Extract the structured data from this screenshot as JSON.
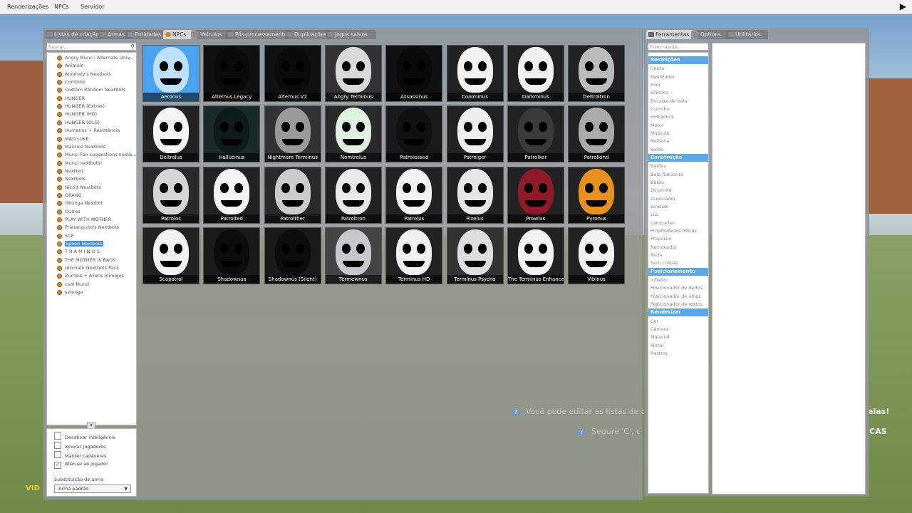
{
  "menubar": {
    "items": [
      "Renderizações",
      "NPCs",
      "Servidor"
    ]
  },
  "tabs": [
    "Listas de criação",
    "Armas",
    "Entidades",
    "NPCs",
    "Veículos",
    "Pós-processamento",
    "Duplicações",
    "Jogos salvos"
  ],
  "active_tab": "NPCs",
  "search_placeholder": "Buscar...",
  "categories": [
    "Angry Munci: Alternate Univ...",
    "Animals",
    "Anomaly's Nextbots",
    "Combine",
    "Custom Random Nextbots",
    "HUNGER",
    "HUNGER (Extras)",
    "HUNGER (HD)",
    "HUNGER (OLD)",
    "Humanos + Resistência",
    "MAD LUKE",
    "Maurice Nextbots",
    "Munci Fan suggestions nextb...",
    "Munci nextbots!",
    "Nextbot",
    "Nextbots",
    "Nico's Nextbots",
    "ORANG",
    "Obunga Nextbot",
    "Outros",
    "PLAY WITH MOTHER",
    "Prietanguito's Nextbots",
    "SCP",
    "Spoon Nextbots",
    "T R A M I N O S",
    "THE MOTHER IS BACK",
    "Ultimate Nextbots Pack",
    "Zumbis + Aliens Inimigos",
    "cool Munci",
    "selenga"
  ],
  "selected_category": "Spoon Nextbots",
  "options": [
    {
      "label": "Desativar inteligência",
      "checked": false
    },
    {
      "label": "Ignorar jogadores",
      "checked": false
    },
    {
      "label": "Manter cadáveres",
      "checked": false
    },
    {
      "label": "Aliar-se ao jogador",
      "checked": true
    }
  ],
  "weapon_label": "Substituição de arma",
  "weapon_value": "Arma padrão",
  "npcs": [
    "Aeronus",
    "Alternus Legacy",
    "Alternus V2",
    "Angry Terminus",
    "Assassinus",
    "Coolminus",
    "Darkminus",
    "Deltroltron",
    "Deltrolus",
    "Hallucinus",
    "Nightmare Terminus",
    "Nomtrolus",
    "Patrolessed",
    "Patrolger",
    "Patrolker",
    "Patrolkind",
    "Patrolos",
    "Patrolted",
    "Patrolther",
    "Patroltron",
    "Patrolus",
    "Pixelus",
    "Prowlus",
    "Pyronus",
    "Scapatrol",
    "Shadownus",
    "Shadownus (Silent)",
    "Termewnus",
    "Terminus HD",
    "Terminus Psycho",
    "The Terminus Enhance",
    "Vibinus"
  ],
  "hints": {
    "line1": "Você pode editar as listas de c",
    "line1_right": "elas!",
    "line2": "Segure 'C', c",
    "line2_right": "CAS",
    "corner": "VID"
  },
  "right_tabs": [
    "Ferramentas",
    "Options",
    "Utilitários"
  ],
  "filter_placeholder": "Filtro rápido...",
  "tool_groups": [
    {
      "name": "Restrições",
      "tools": [
        "Corda",
        "Deslizador",
        "Eixo",
        "Elástico",
        "Encaixe de bola",
        "Guincho",
        "Hidráulica",
        "Motor",
        "Músculo",
        "Roldana",
        "Solda"
      ]
    },
    {
      "name": "Construção",
      "tools": [
        "Balões",
        "Bola flutuante",
        "Botão",
        "Dinamite",
        "Duplicador",
        "Emissor",
        "Luz",
        "Lâmpadas",
        "Propriedades físicas",
        "Propulsor",
        "Removedor",
        "Roda",
        "Sem colisão"
      ]
    },
    {
      "name": "Posicionamento",
      "tools": [
        "Inflador",
        "Posicionador de dedos",
        "Posicionador de olhos",
        "Posicionador de rostos"
      ]
    },
    {
      "name": "Renderizar",
      "tools": [
        "Cor",
        "Câmera",
        "Material",
        "Pintar",
        "Rastros"
      ]
    }
  ]
}
